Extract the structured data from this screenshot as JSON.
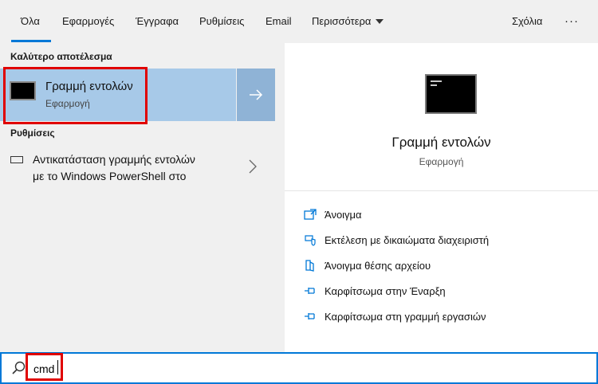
{
  "tabs": {
    "all": "Όλα",
    "apps": "Εφαρμογές",
    "documents": "Έγγραφα",
    "settings": "Ρυθμίσεις",
    "email": "Email",
    "more": "Περισσότερα",
    "feedback": "Σχόλια",
    "options": "···"
  },
  "left": {
    "best_match_label": "Καλύτερο αποτέλεσμα",
    "best_match": {
      "title": "Γραμμή εντολών",
      "subtitle": "Εφαρμογή"
    },
    "settings_label": "Ρυθμίσεις",
    "settings_item": {
      "line1": "Αντικατάσταση γραμμής εντολών",
      "line2": "με το Windows PowerShell στο"
    }
  },
  "right": {
    "title": "Γραμμή εντολών",
    "subtitle": "Εφαρμογή",
    "actions": [
      {
        "label": "Άνοιγμα",
        "icon": "open-icon"
      },
      {
        "label": "Εκτέλεση με δικαιώματα διαχειριστή",
        "icon": "admin-shield-icon"
      },
      {
        "label": "Άνοιγμα θέσης αρχείου",
        "icon": "file-location-icon"
      },
      {
        "label": "Καρφίτσωμα στην Έναρξη",
        "icon": "pin-icon"
      },
      {
        "label": "Καρφίτσωμα στη γραμμή εργασιών",
        "icon": "pin-icon"
      }
    ]
  },
  "search": {
    "value": "cmd"
  },
  "colors": {
    "accent": "#0078d7",
    "selection": "#a7c9e8",
    "highlight": "#e00000"
  }
}
